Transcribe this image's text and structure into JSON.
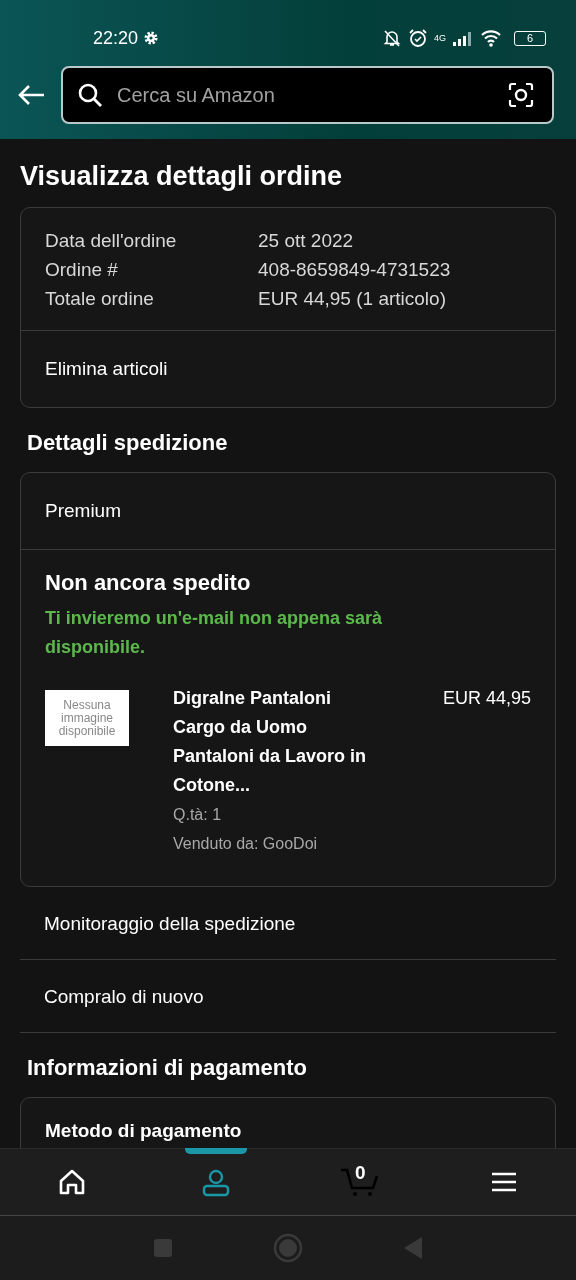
{
  "status_bar": {
    "time": "22:20",
    "network": "4G",
    "battery": "6"
  },
  "search": {
    "placeholder": "Cerca su Amazon"
  },
  "title": "Visualizza dettagli ordine",
  "order_summary": [
    {
      "label": "Data dell'ordine",
      "value": "25 ott 2022"
    },
    {
      "label": "Ordine #",
      "value": "408-8659849-4731523"
    },
    {
      "label": "Totale ordine",
      "value": "EUR 44,95 (1 articolo)"
    }
  ],
  "order_actions": [
    "Elimina articoli"
  ],
  "shipping": {
    "heading": "Dettagli spedizione",
    "speed": "Premium",
    "status": "Non ancora spedito",
    "note": "Ti invieremo un'e-mail non appena sarà disponibile.",
    "item": {
      "no_image_label": "Nessuna immagine disponibile",
      "title": "Digralne Pantaloni Cargo da Uomo Pantaloni da Lavoro in Cotone...",
      "price": "EUR 44,95",
      "quantity": "Q.tà: 1",
      "seller": "Venduto da: GooDoi"
    }
  },
  "shipping_actions": [
    "Monitoraggio della spedizione",
    "Compralo di nuovo"
  ],
  "payment": {
    "heading": "Informazioni di pagamento",
    "method_label": "Metodo di pagamento"
  },
  "bottom_nav": [
    {
      "kind": "home",
      "selected": false
    },
    {
      "kind": "account",
      "selected": true
    },
    {
      "kind": "cart",
      "count": "0",
      "selected": false
    },
    {
      "kind": "menu",
      "selected": false
    }
  ]
}
